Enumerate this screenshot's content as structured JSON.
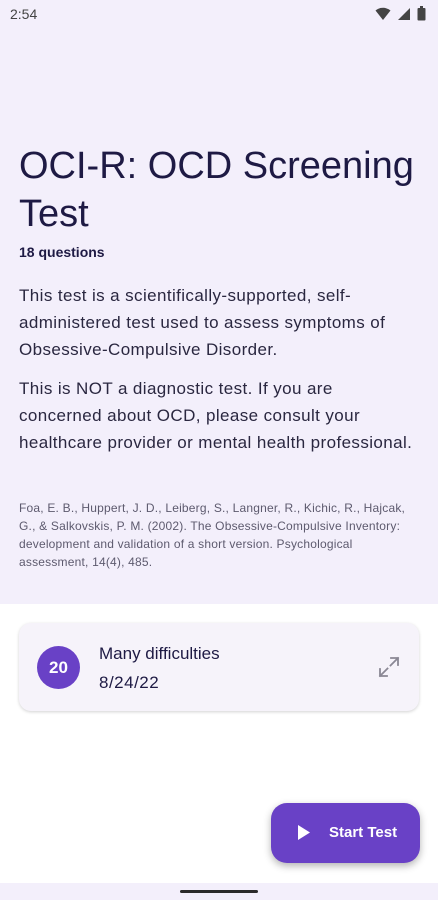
{
  "status_bar": {
    "time": "2:54"
  },
  "header": {
    "title": "OCI-R: OCD Screening Test",
    "question_count": "18 questions"
  },
  "description": {
    "paragraph1": "This test is a scientifically-supported, self-administered test used to assess symptoms of Obsessive-Compulsive Disorder.",
    "paragraph2": "This is NOT a diagnostic test. If you are concerned about OCD, please consult your healthcare provider or mental health professional.",
    "citation": "Foa, E. B., Huppert, J. D., Leiberg, S., Langner, R., Kichic, R., Hajcak, G., & Salkovskis, P. M. (2002). The Obsessive-Compulsive Inventory: development and validation of a short version. Psychological assessment, 14(4), 485."
  },
  "result": {
    "score": "20",
    "label": "Many difficulties",
    "date": "8/24/22",
    "icon": "expand-icon"
  },
  "fab": {
    "label": "Start Test",
    "icon": "play-icon"
  },
  "colors": {
    "accent": "#6941c6",
    "header_bg": "#f3effb"
  }
}
